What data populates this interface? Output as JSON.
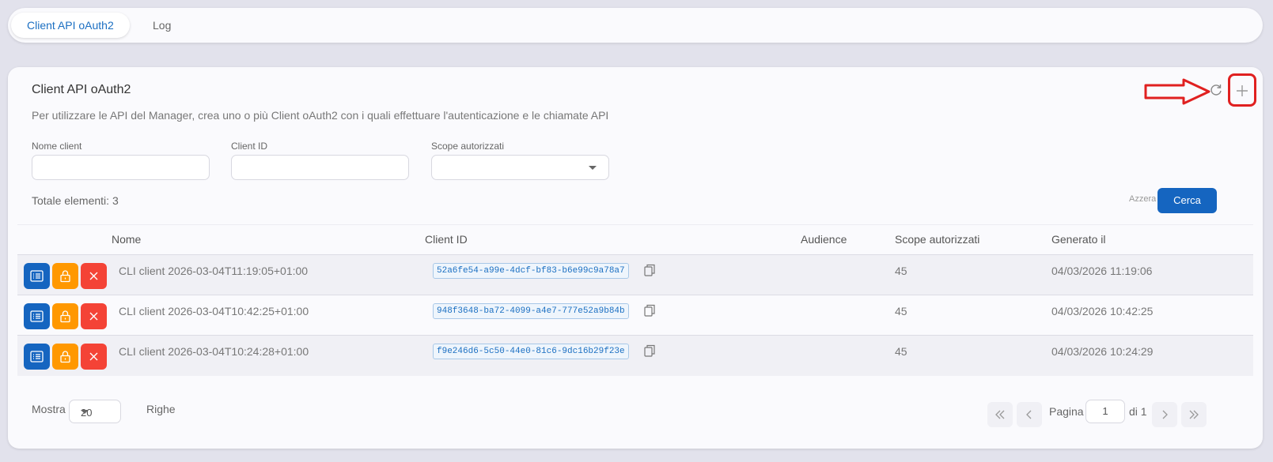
{
  "tabs": [
    {
      "label": "Client API oAuth2",
      "active": true
    },
    {
      "label": "Log",
      "active": false
    }
  ],
  "card": {
    "title": "Client API oAuth2",
    "subtitle": "Per utilizzare le API del Manager, crea uno o più Client oAuth2 con i quali effettuare l'autenticazione e le chiamate API"
  },
  "filters": {
    "name_label": "Nome client",
    "name_value": "",
    "client_id_label": "Client ID",
    "client_id_value": "",
    "scope_label": "Scope autorizzati",
    "scope_value": ""
  },
  "toolbar": {
    "total_text": "Totale elementi: 3",
    "reset_label": "Azzera",
    "search_label": "Cerca"
  },
  "table": {
    "columns": [
      "Nome",
      "Client ID",
      "Audience",
      "Scope autorizzati",
      "Generato il"
    ],
    "rows": [
      {
        "name": "CLI client 2026-03-04T11:19:05+01:00",
        "client_id": "52a6fe54-a99e-4dcf-bf83-b6e99c9a78a7",
        "audience": "",
        "scope": "45",
        "generated": "04/03/2026 11:19:06"
      },
      {
        "name": "CLI client 2026-03-04T10:42:25+01:00",
        "client_id": "948f3648-ba72-4099-a4e7-777e52a9b84b",
        "audience": "",
        "scope": "45",
        "generated": "04/03/2026 10:42:25"
      },
      {
        "name": "CLI client 2026-03-04T10:24:28+01:00",
        "client_id": "f9e246d6-5c50-44e0-81c6-9dc16b29f23e",
        "audience": "",
        "scope": "45",
        "generated": "04/03/2026 10:24:29"
      }
    ]
  },
  "footer": {
    "show_label": "Mostra",
    "rows_per_page": "20",
    "rows_label": "Righe",
    "page_label": "Pagina",
    "page_value": "1",
    "of_label": "di 1"
  },
  "colors": {
    "primary": "#1565c0",
    "lock": "#ff9800",
    "delete": "#f44336",
    "annotation": "#e02020"
  },
  "icons": {
    "refresh": "refresh-icon",
    "add": "plus-icon",
    "detail": "list-icon",
    "lock": "lock-icon",
    "delete": "close-icon",
    "copy": "copy-icon",
    "first": "double-chevron-left-icon",
    "prev": "chevron-left-icon",
    "next": "chevron-right-icon",
    "last": "double-chevron-right-icon"
  }
}
